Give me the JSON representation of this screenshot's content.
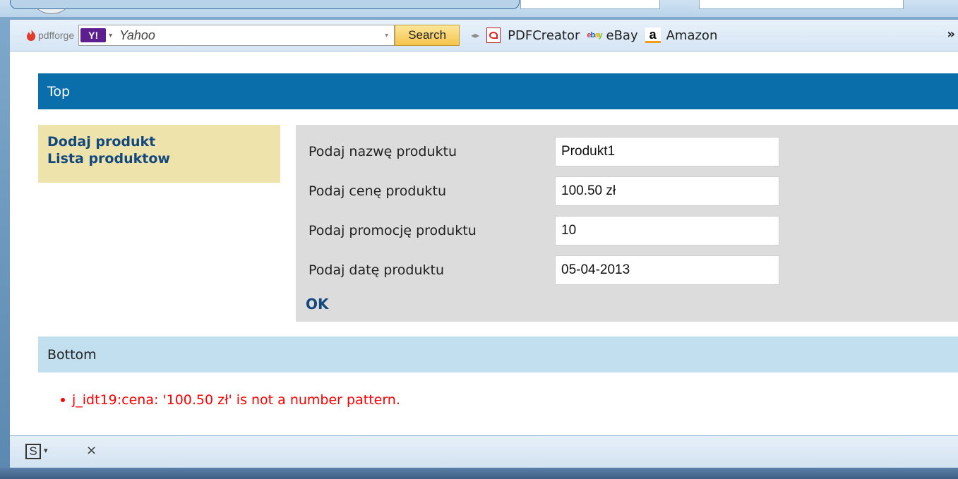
{
  "toolbar": {
    "pdfforge_label": "pdfforge",
    "yahoo_logo": "Y!",
    "search_placeholder": "Yahoo",
    "search_button": "Search",
    "bookmarks": [
      {
        "label": "PDFCreator",
        "icon": "pdf-icon"
      },
      {
        "label": "eBay",
        "icon": "ebay-icon"
      },
      {
        "label": "Amazon",
        "icon": "amazon-icon"
      }
    ],
    "more": "»"
  },
  "page": {
    "top_bar": "Top",
    "menu": [
      "Dodaj produkt",
      "Lista produktow"
    ],
    "form": {
      "rows": [
        {
          "label": "Podaj nazwę produktu",
          "value": "Produkt1"
        },
        {
          "label": "Podaj cenę produktu",
          "value": "100.50 zł"
        },
        {
          "label": "Podaj promocję produktu",
          "value": "10"
        },
        {
          "label": "Podaj datę produktu",
          "value": "05-04-2013"
        }
      ],
      "submit": "OK"
    },
    "bottom_bar": "Bottom",
    "errors": [
      "j_idt19:cena: '100.50 zł' is not a number pattern."
    ]
  },
  "statusbar": {
    "s_icon": "S",
    "dropdown": "▾",
    "close": "×"
  },
  "colors": {
    "top_bar": "#0a6eab",
    "bottom_bar": "#c2dff0",
    "menu_bg": "#ede3ab",
    "form_bg": "#dcdcdc",
    "link": "#13487e",
    "error": "#ff0000"
  }
}
